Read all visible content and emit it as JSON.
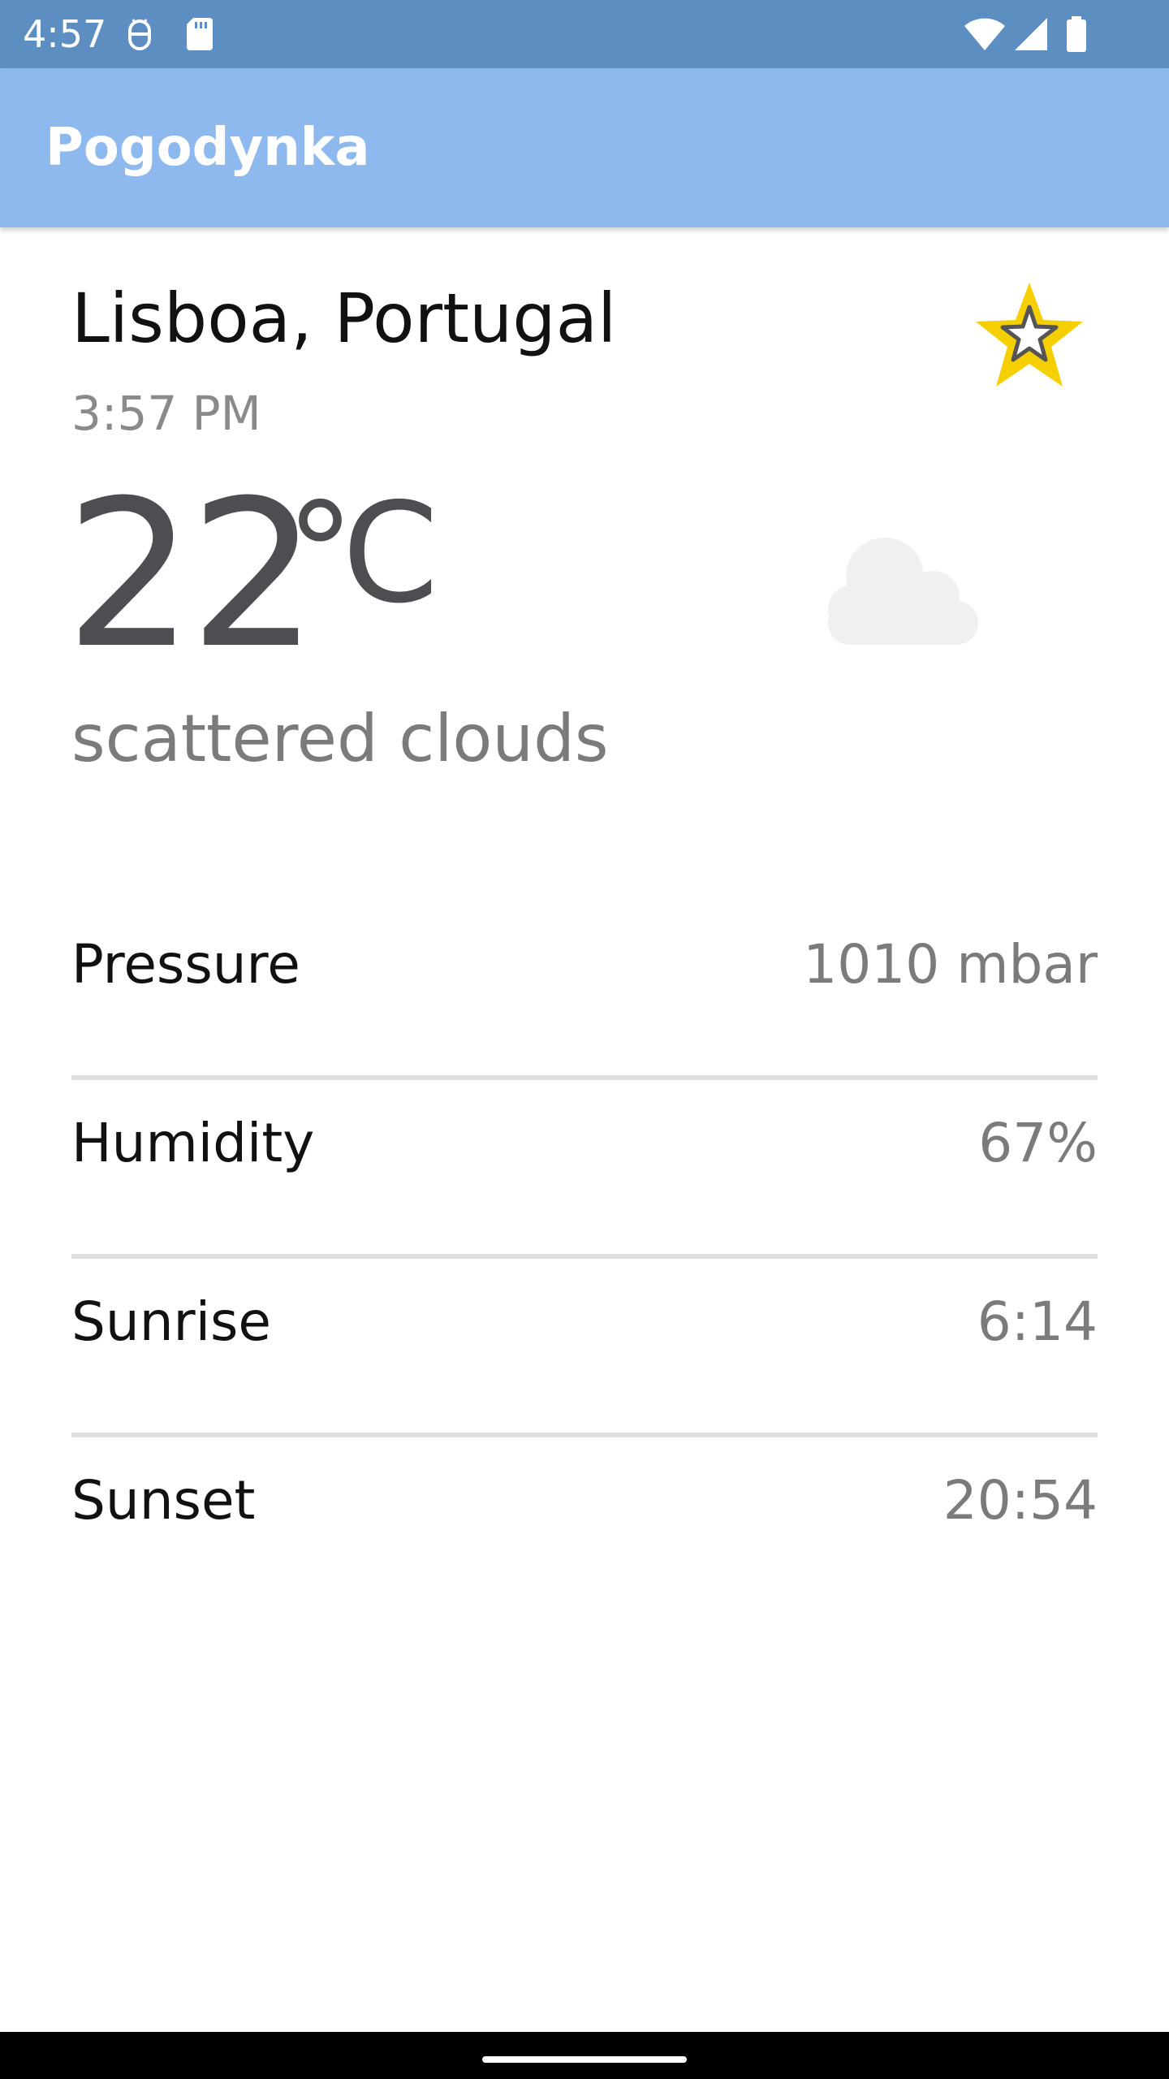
{
  "status_bar": {
    "time": "4:57",
    "background_color": "#5d8ec2",
    "left_icons": [
      "android-debug-icon",
      "sd-card-icon"
    ],
    "right_icons": [
      "wifi-icon",
      "cellular-signal-icon",
      "battery-icon"
    ]
  },
  "app_bar": {
    "title": "Pogodynka",
    "background_color": "#8db9ef"
  },
  "weather": {
    "city": "Lisboa, Portugal",
    "local_time": "3:57 PM",
    "temperature": "22",
    "unit": "℃",
    "description": "scattered clouds",
    "condition_icon": "cloud-icon",
    "favorite_icon": "star-icon",
    "favorite_color": "#f5cf00"
  },
  "details": [
    {
      "label": "Pressure",
      "value": "1010 mbar"
    },
    {
      "label": "Humidity",
      "value": "67%"
    },
    {
      "label": "Sunrise",
      "value": "6:14"
    },
    {
      "label": "Sunset",
      "value": "20:54"
    }
  ]
}
